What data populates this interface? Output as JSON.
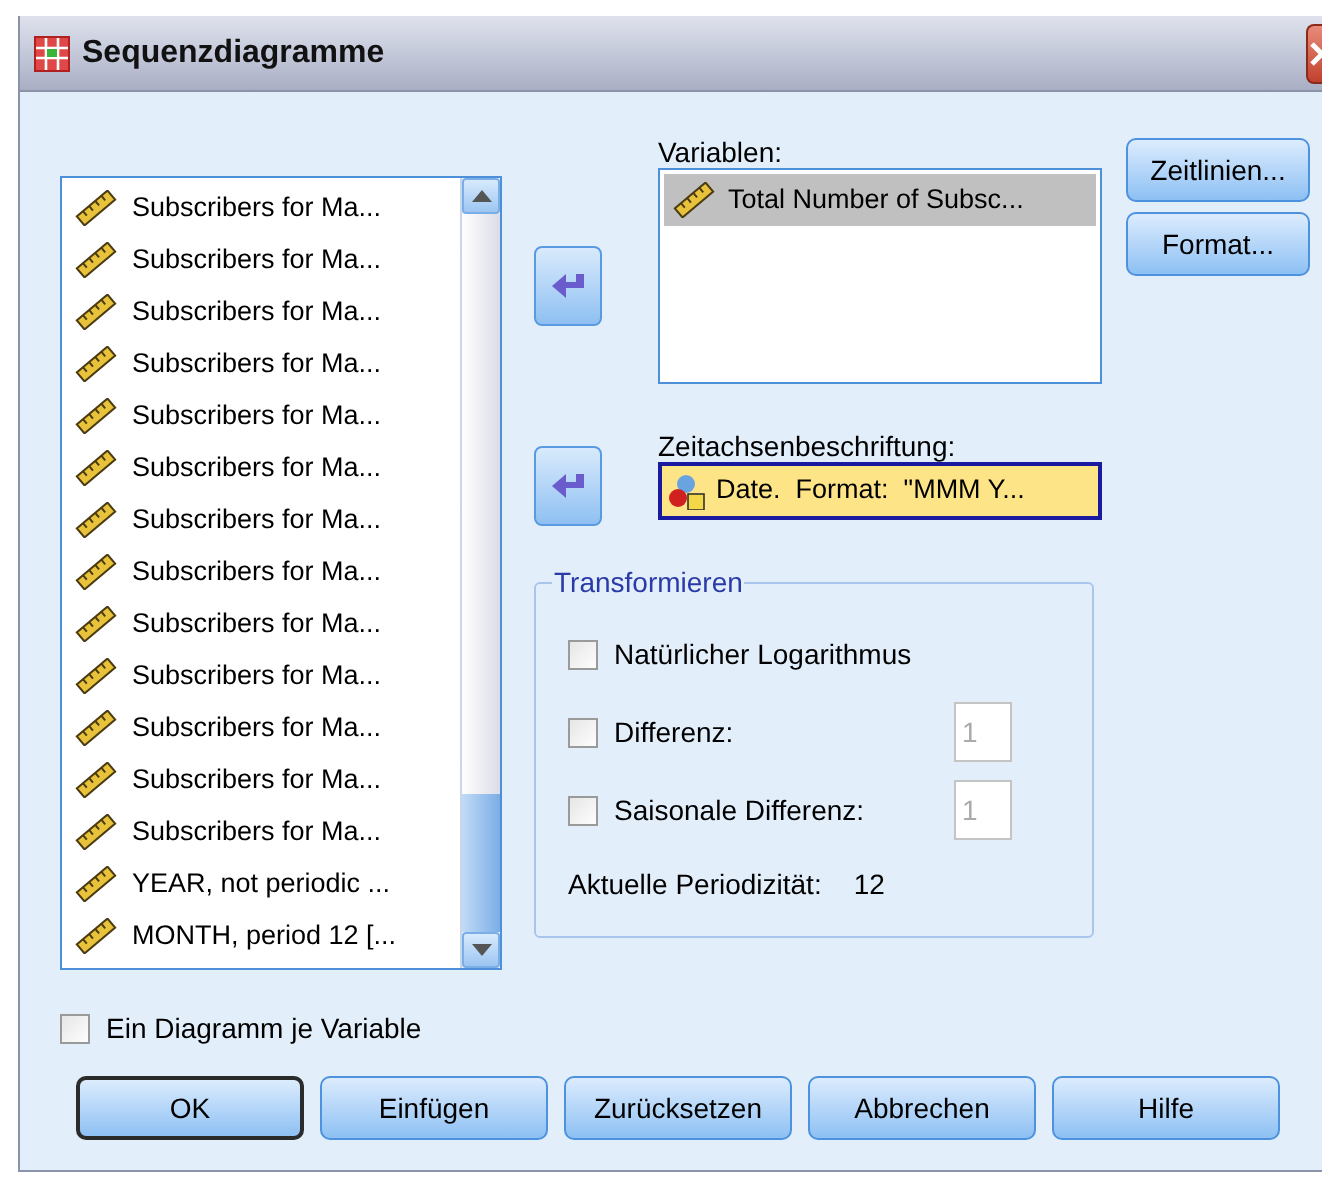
{
  "window": {
    "title": "Sequenzdiagramme"
  },
  "source_list": {
    "items": [
      {
        "label": "Subscribers for Ma...",
        "kind": "scale",
        "selected": false
      },
      {
        "label": "Subscribers for Ma...",
        "kind": "scale",
        "selected": false
      },
      {
        "label": "Subscribers for Ma...",
        "kind": "scale",
        "selected": false
      },
      {
        "label": "Subscribers for Ma...",
        "kind": "scale",
        "selected": false
      },
      {
        "label": "Subscribers for Ma...",
        "kind": "scale",
        "selected": false
      },
      {
        "label": "Subscribers for Ma...",
        "kind": "scale",
        "selected": false
      },
      {
        "label": "Subscribers for Ma...",
        "kind": "scale",
        "selected": false
      },
      {
        "label": "Subscribers for Ma...",
        "kind": "scale",
        "selected": false
      },
      {
        "label": "Subscribers for Ma...",
        "kind": "scale",
        "selected": false
      },
      {
        "label": "Subscribers for Ma...",
        "kind": "scale",
        "selected": false
      },
      {
        "label": "Subscribers for Ma...",
        "kind": "scale",
        "selected": false
      },
      {
        "label": "Subscribers for Ma...",
        "kind": "scale",
        "selected": false
      },
      {
        "label": "Subscribers for Ma...",
        "kind": "scale",
        "selected": false
      },
      {
        "label": "YEAR, not periodic ...",
        "kind": "scale",
        "selected": false
      },
      {
        "label": "MONTH, period 12 [...",
        "kind": "scale",
        "selected": false
      }
    ]
  },
  "variables": {
    "label": "Variablen:",
    "items": [
      {
        "label": "Total Number of Subsc...",
        "kind": "scale",
        "selected": true
      }
    ]
  },
  "time_axis": {
    "label": "Zeitachsenbeschriftung:",
    "value": "Date.  Format:  \"MMM Y...",
    "kind": "date",
    "selected": true
  },
  "side_buttons": [
    "Zeitlinien...",
    "Format..."
  ],
  "transform": {
    "title": "Transformieren",
    "options": [
      {
        "label": "Natürlicher Logarithmus",
        "checked": false
      },
      {
        "label": "Differenz:",
        "checked": false,
        "value": "1",
        "disabled": true
      },
      {
        "label": "Saisonale Differenz:",
        "checked": false,
        "value": "1",
        "disabled": true
      }
    ],
    "periodicity_label": "Aktuelle Periodizität:",
    "periodicity_value": "12"
  },
  "one_chart_per_variable": {
    "label": "Ein Diagramm je Variable",
    "checked": false
  },
  "buttons": [
    {
      "label": "OK",
      "default": true
    },
    {
      "label": "Einfügen",
      "default": false
    },
    {
      "label": "Zurücksetzen",
      "default": false
    },
    {
      "label": "Abbrechen",
      "default": false
    },
    {
      "label": "Hilfe",
      "default": false
    }
  ]
}
